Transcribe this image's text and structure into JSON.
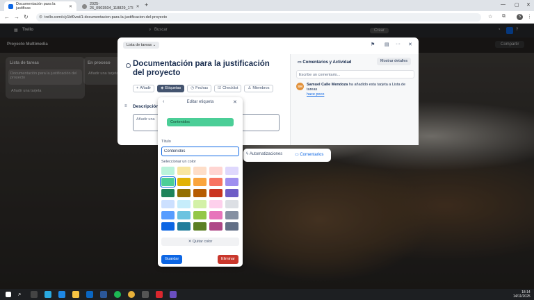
{
  "browser": {
    "tabs": [
      {
        "title": "Documentación para la justificac"
      },
      {
        "title": "2025-26_0903504_118829_1TI"
      }
    ],
    "url": "trello.com/c/y1bf0vwi/1-documentacion-para-la-justificacion-del-proyecto"
  },
  "trello": {
    "logo": "Trello",
    "search_placeholder": "Buscar",
    "create_label": "Crear",
    "board_title": "Proyecto Multimedia",
    "share_label": "Compartir",
    "lists": [
      {
        "title": "Lista de tareas",
        "card": "Documentación para la justificación del proyecto",
        "add": "Añadir una tarjeta"
      },
      {
        "title": "En proceso",
        "card": "Añadir una tarjeta",
        "add": ""
      }
    ]
  },
  "card": {
    "list_badge": "Lista de tareas",
    "title": "Documentación para la justificación del proyecto",
    "actions": [
      "Añadir",
      "Etiquetas",
      "Fechas",
      "Checklist",
      "Miembros"
    ],
    "description_label": "Descripción",
    "description_placeholder": "Añadir una",
    "sidebar_title": "Comentarios y Actividad",
    "details_button": "Mostrar detalles",
    "comment_placeholder": "Escribe un comentario...",
    "activity": {
      "initials": "SM",
      "user": "Samuel Calle Mendoza",
      "text": " ha añadido esta tarjeta a Lista de tareas",
      "ago": "hace poco"
    }
  },
  "floating_bar": {
    "automations": "Automatizaciones",
    "comments": "Comentarios"
  },
  "label_editor": {
    "title": "Editar etiqueta",
    "preview_text": "Contenidos",
    "title_label": "Título",
    "title_value": "Contenidos",
    "color_label": "Seleccionar un color",
    "remove_color": "Quitar color",
    "save": "Guardar",
    "delete": "Eliminar",
    "colors": [
      "#baf3db",
      "#f8e6a0",
      "#fedec8",
      "#ffd5d2",
      "#dfd8fd",
      "#4bce97",
      "#e2b203",
      "#faa53d",
      "#f87462",
      "#9f8fef",
      "#1f845a",
      "#946f00",
      "#b65c02",
      "#ca3521",
      "#6e5dc6",
      "#cce0ff",
      "#c6edfb",
      "#d3f1a7",
      "#fdd0ec",
      "#dcdfe4",
      "#579dff",
      "#6cc3e0",
      "#94c748",
      "#e774bb",
      "#8590a2",
      "#0c66e4",
      "#227d9b",
      "#5b7f24",
      "#ae4787",
      "#626f86"
    ],
    "selected_index": 5
  },
  "taskbar": {
    "time": "18:14",
    "date": "14/11/2025"
  }
}
